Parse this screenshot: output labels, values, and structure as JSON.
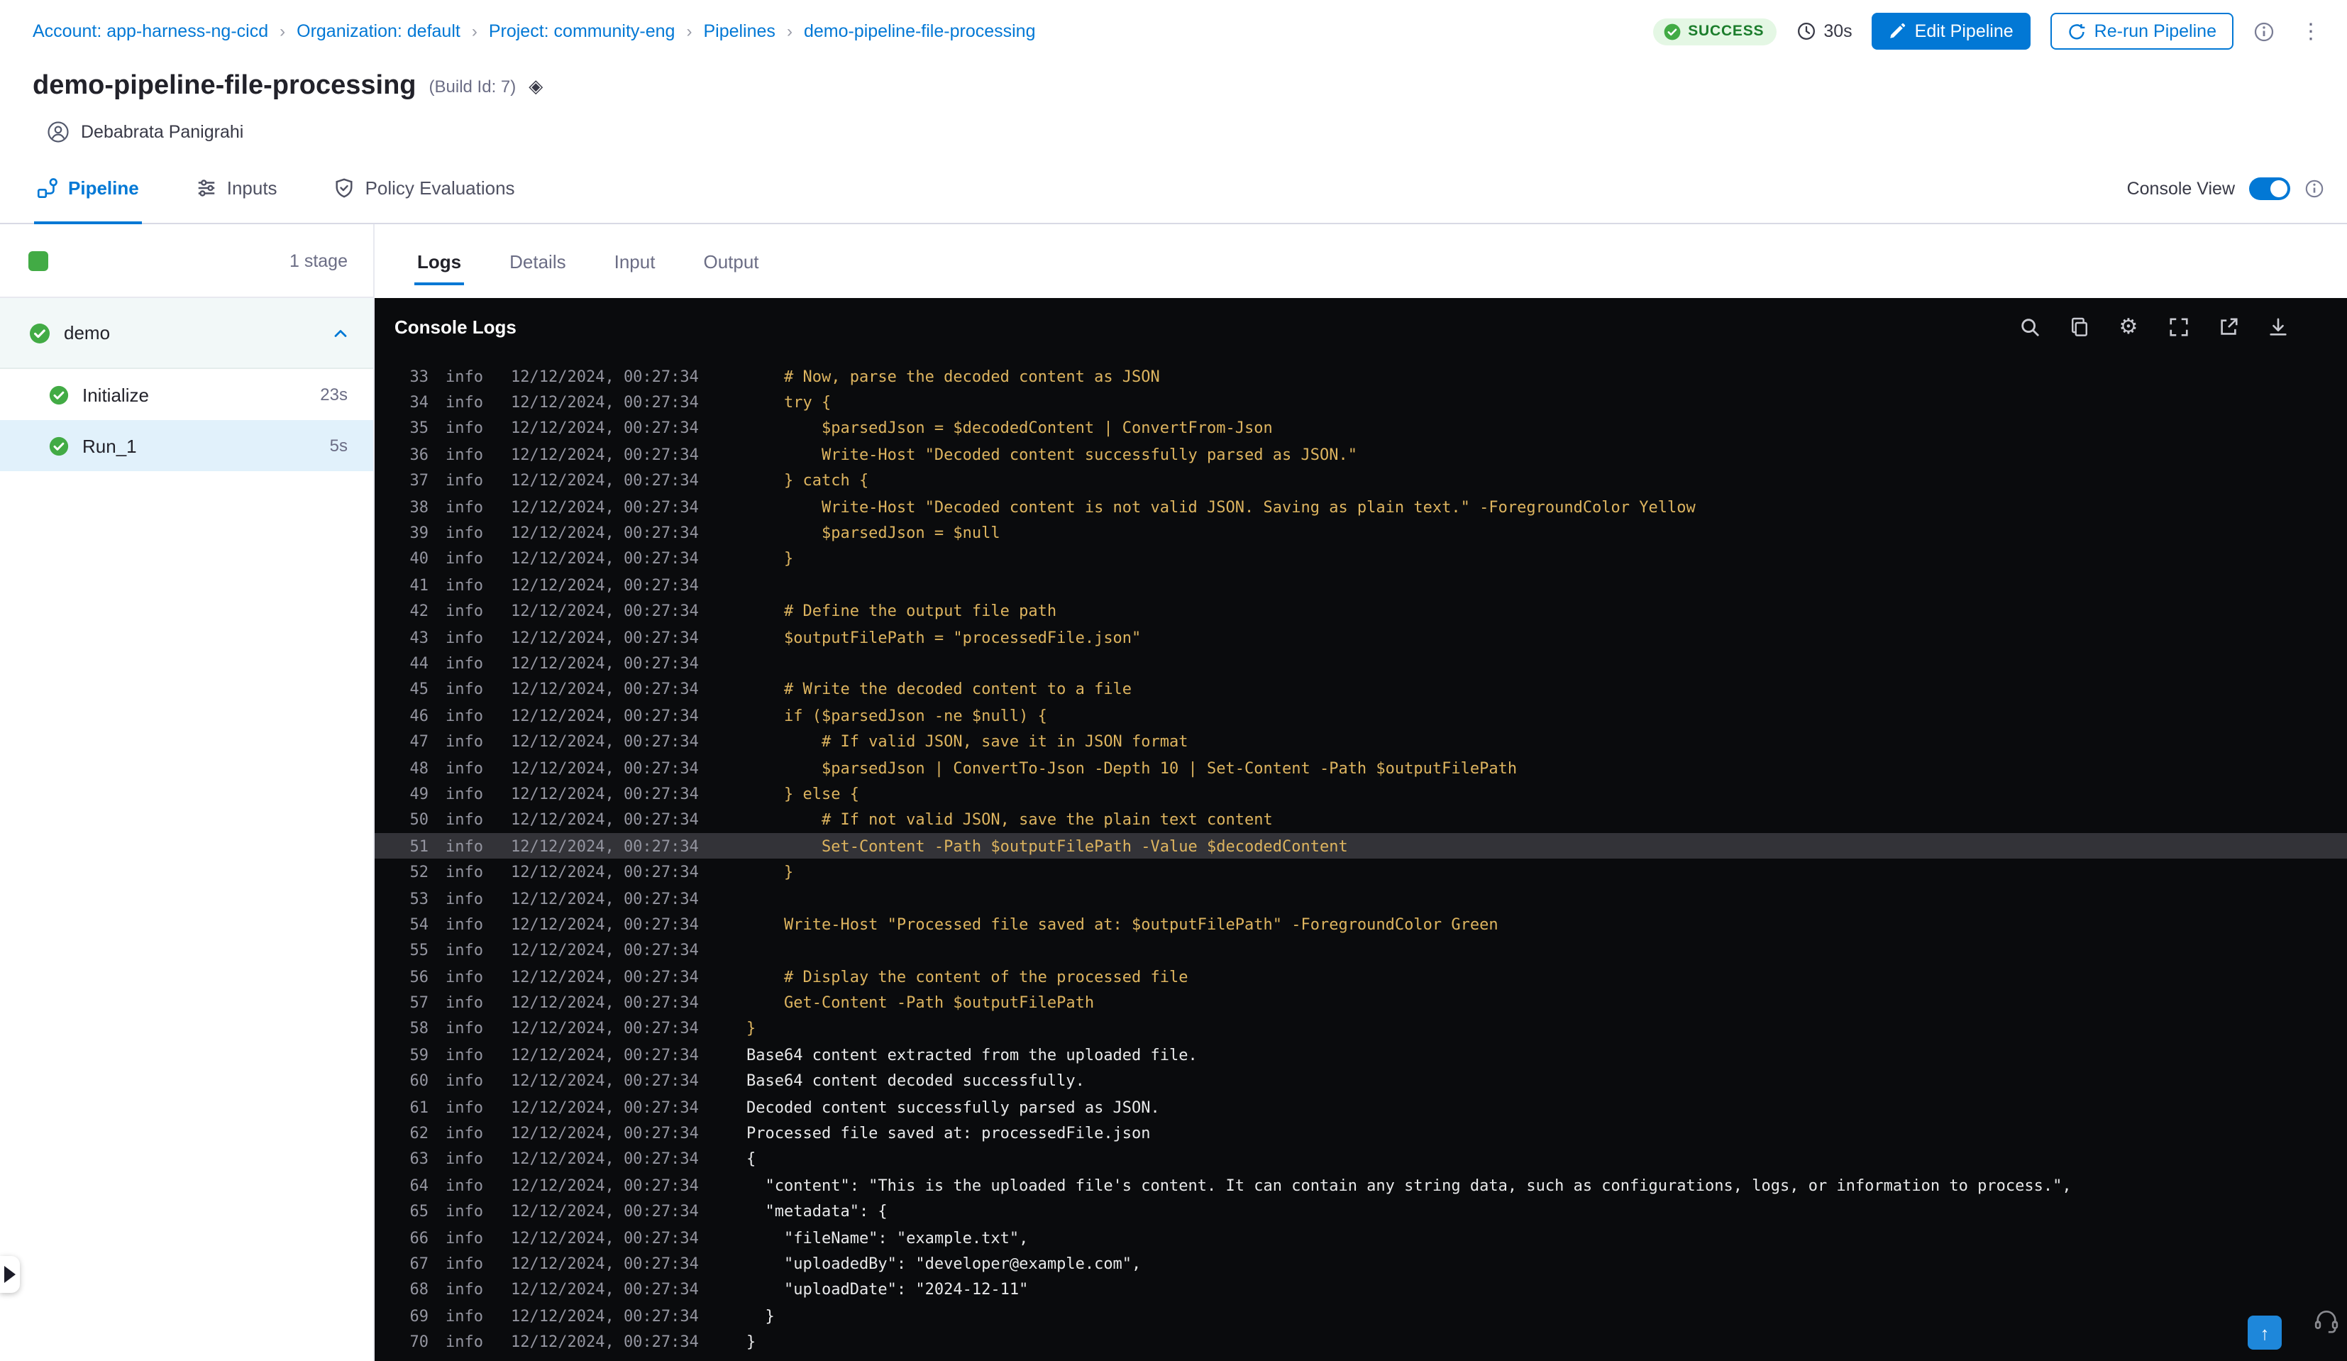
{
  "colors": {
    "accent": "#0278d5",
    "success": "#42ab45",
    "success_badge_bg": "#e4f7e4",
    "success_badge_text": "#1b7d2c",
    "console_bg": "#0a0b0d",
    "log_script": "#ddb45f",
    "log_output": "#e8e9ea",
    "log_meta": "#9495a0",
    "selected_step_bg": "#e1f1fb",
    "highlight_line_bg": "#333338"
  },
  "icons": {
    "breadcrumb_separator": "›",
    "kebab": "⋮",
    "gear": "⚙",
    "up_arrow": "↑",
    "diamond": "◈"
  },
  "breadcrumb": {
    "items": [
      "Account: app-harness-ng-cicd",
      "Organization: default",
      "Project: community-eng",
      "Pipelines",
      "demo-pipeline-file-processing"
    ]
  },
  "header": {
    "status": "SUCCESS",
    "duration": "30s",
    "edit_button": "Edit Pipeline",
    "rerun_button": "Re-run Pipeline",
    "title": "demo-pipeline-file-processing",
    "build_id": "(Build Id: 7)",
    "user": "Debabrata Panigrahi"
  },
  "tabs": {
    "active": "Pipeline",
    "items": [
      {
        "label": "Pipeline",
        "icon": "pipeline"
      },
      {
        "label": "Inputs",
        "icon": "inputs"
      },
      {
        "label": "Policy Evaluations",
        "icon": "policy"
      }
    ],
    "console_view_label": "Console View",
    "console_view_on": true
  },
  "sidebar": {
    "stage_count": "1 stage",
    "stage_group": "demo",
    "steps": [
      {
        "name": "Initialize",
        "duration": "23s",
        "selected": false
      },
      {
        "name": "Run_1",
        "duration": "5s",
        "selected": true
      }
    ]
  },
  "log_tabs": {
    "active": "Logs",
    "items": [
      "Logs",
      "Details",
      "Input",
      "Output"
    ]
  },
  "console": {
    "title": "Console Logs",
    "icons": [
      "search",
      "copy",
      "settings",
      "fullscreen",
      "open-in-new",
      "download"
    ],
    "lines": [
      {
        "n": 33,
        "level": "info",
        "ts": "12/12/2024, 00:27:34",
        "kind": "script",
        "text": "    # Now, parse the decoded content as JSON"
      },
      {
        "n": 34,
        "level": "info",
        "ts": "12/12/2024, 00:27:34",
        "kind": "script",
        "text": "    try {"
      },
      {
        "n": 35,
        "level": "info",
        "ts": "12/12/2024, 00:27:34",
        "kind": "script",
        "text": "        $parsedJson = $decodedContent | ConvertFrom-Json"
      },
      {
        "n": 36,
        "level": "info",
        "ts": "12/12/2024, 00:27:34",
        "kind": "script",
        "text": "        Write-Host \"Decoded content successfully parsed as JSON.\""
      },
      {
        "n": 37,
        "level": "info",
        "ts": "12/12/2024, 00:27:34",
        "kind": "script",
        "text": "    } catch {"
      },
      {
        "n": 38,
        "level": "info",
        "ts": "12/12/2024, 00:27:34",
        "kind": "script",
        "text": "        Write-Host \"Decoded content is not valid JSON. Saving as plain text.\" -ForegroundColor Yellow"
      },
      {
        "n": 39,
        "level": "info",
        "ts": "12/12/2024, 00:27:34",
        "kind": "script",
        "text": "        $parsedJson = $null"
      },
      {
        "n": 40,
        "level": "info",
        "ts": "12/12/2024, 00:27:34",
        "kind": "script",
        "text": "    }"
      },
      {
        "n": 41,
        "level": "info",
        "ts": "12/12/2024, 00:27:34",
        "kind": "script",
        "text": ""
      },
      {
        "n": 42,
        "level": "info",
        "ts": "12/12/2024, 00:27:34",
        "kind": "script",
        "text": "    # Define the output file path"
      },
      {
        "n": 43,
        "level": "info",
        "ts": "12/12/2024, 00:27:34",
        "kind": "script",
        "text": "    $outputFilePath = \"processedFile.json\""
      },
      {
        "n": 44,
        "level": "info",
        "ts": "12/12/2024, 00:27:34",
        "kind": "script",
        "text": ""
      },
      {
        "n": 45,
        "level": "info",
        "ts": "12/12/2024, 00:27:34",
        "kind": "script",
        "text": "    # Write the decoded content to a file"
      },
      {
        "n": 46,
        "level": "info",
        "ts": "12/12/2024, 00:27:34",
        "kind": "script",
        "text": "    if ($parsedJson -ne $null) {"
      },
      {
        "n": 47,
        "level": "info",
        "ts": "12/12/2024, 00:27:34",
        "kind": "script",
        "text": "        # If valid JSON, save it in JSON format"
      },
      {
        "n": 48,
        "level": "info",
        "ts": "12/12/2024, 00:27:34",
        "kind": "script",
        "text": "        $parsedJson | ConvertTo-Json -Depth 10 | Set-Content -Path $outputFilePath"
      },
      {
        "n": 49,
        "level": "info",
        "ts": "12/12/2024, 00:27:34",
        "kind": "script",
        "text": "    } else {"
      },
      {
        "n": 50,
        "level": "info",
        "ts": "12/12/2024, 00:27:34",
        "kind": "script",
        "text": "        # If not valid JSON, save the plain text content"
      },
      {
        "n": 51,
        "level": "info",
        "ts": "12/12/2024, 00:27:34",
        "kind": "script",
        "hl": true,
        "text": "        Set-Content -Path $outputFilePath -Value $decodedContent"
      },
      {
        "n": 52,
        "level": "info",
        "ts": "12/12/2024, 00:27:34",
        "kind": "script",
        "text": "    }"
      },
      {
        "n": 53,
        "level": "info",
        "ts": "12/12/2024, 00:27:34",
        "kind": "script",
        "text": ""
      },
      {
        "n": 54,
        "level": "info",
        "ts": "12/12/2024, 00:27:34",
        "kind": "script",
        "text": "    Write-Host \"Processed file saved at: $outputFilePath\" -ForegroundColor Green"
      },
      {
        "n": 55,
        "level": "info",
        "ts": "12/12/2024, 00:27:34",
        "kind": "script",
        "text": ""
      },
      {
        "n": 56,
        "level": "info",
        "ts": "12/12/2024, 00:27:34",
        "kind": "script",
        "text": "    # Display the content of the processed file"
      },
      {
        "n": 57,
        "level": "info",
        "ts": "12/12/2024, 00:27:34",
        "kind": "script",
        "text": "    Get-Content -Path $outputFilePath"
      },
      {
        "n": 58,
        "level": "info",
        "ts": "12/12/2024, 00:27:34",
        "kind": "script",
        "text": "}"
      },
      {
        "n": 59,
        "level": "info",
        "ts": "12/12/2024, 00:27:34",
        "kind": "out",
        "text": "Base64 content extracted from the uploaded file."
      },
      {
        "n": 60,
        "level": "info",
        "ts": "12/12/2024, 00:27:34",
        "kind": "out",
        "text": "Base64 content decoded successfully."
      },
      {
        "n": 61,
        "level": "info",
        "ts": "12/12/2024, 00:27:34",
        "kind": "out",
        "text": "Decoded content successfully parsed as JSON."
      },
      {
        "n": 62,
        "level": "info",
        "ts": "12/12/2024, 00:27:34",
        "kind": "out",
        "text": "Processed file saved at: processedFile.json"
      },
      {
        "n": 63,
        "level": "info",
        "ts": "12/12/2024, 00:27:34",
        "kind": "out",
        "text": "{"
      },
      {
        "n": 64,
        "level": "info",
        "ts": "12/12/2024, 00:27:34",
        "kind": "out",
        "text": "  \"content\": \"This is the uploaded file's content. It can contain any string data, such as configurations, logs, or information to process.\","
      },
      {
        "n": 65,
        "level": "info",
        "ts": "12/12/2024, 00:27:34",
        "kind": "out",
        "text": "  \"metadata\": {"
      },
      {
        "n": 66,
        "level": "info",
        "ts": "12/12/2024, 00:27:34",
        "kind": "out",
        "text": "    \"fileName\": \"example.txt\","
      },
      {
        "n": 67,
        "level": "info",
        "ts": "12/12/2024, 00:27:34",
        "kind": "out",
        "text": "    \"uploadedBy\": \"developer@example.com\","
      },
      {
        "n": 68,
        "level": "info",
        "ts": "12/12/2024, 00:27:34",
        "kind": "out",
        "text": "    \"uploadDate\": \"2024-12-11\""
      },
      {
        "n": 69,
        "level": "info",
        "ts": "12/12/2024, 00:27:34",
        "kind": "out",
        "text": "  }"
      },
      {
        "n": 70,
        "level": "info",
        "ts": "12/12/2024, 00:27:34",
        "kind": "out",
        "text": "}"
      }
    ]
  }
}
